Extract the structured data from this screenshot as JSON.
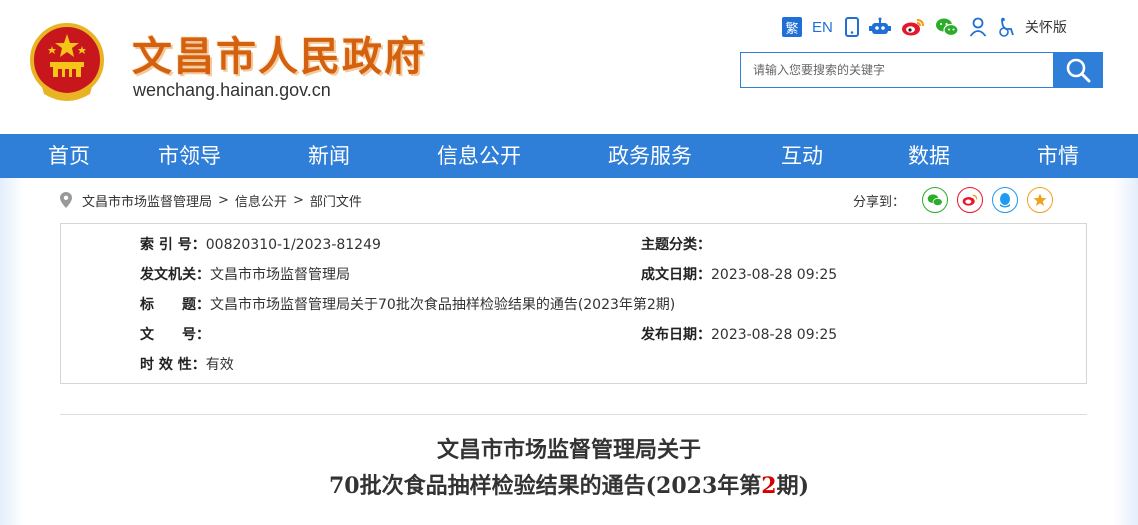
{
  "header": {
    "site_title": "文昌市人民政府",
    "site_domain": "wenchang.hainan.gov.cn",
    "tools": {
      "traditional": "繁",
      "english": "EN",
      "care_mode": "关怀版"
    },
    "search": {
      "placeholder": "请输入您要搜索的关键字"
    }
  },
  "nav": {
    "items": [
      "首页",
      "市领导",
      "新闻",
      "信息公开",
      "政务服务",
      "互动",
      "数据",
      "市情"
    ]
  },
  "breadcrumb": {
    "items": [
      "文昌市市场监督管理局",
      "信息公开",
      "部门文件"
    ],
    "separator": ">"
  },
  "share": {
    "label": "分享到："
  },
  "meta": {
    "index_label": "索 引 号：",
    "index_value": "00820310-1/2023-81249",
    "topic_label": "主题分类：",
    "topic_value": "",
    "issuer_label": "发文机关：",
    "issuer_value": "文昌市市场监督管理局",
    "created_label": "成文日期：",
    "created_value": "2023-08-28 09:25",
    "title_label": "标　　题：",
    "title_value": "文昌市市场监督管理局关于70批次食品抽样检验结果的通告(2023年第2期)",
    "docno_label": "文　　号：",
    "docno_value": "",
    "published_label": "发布日期：",
    "published_value": "2023-08-28 09:25",
    "validity_label": "时 效 性：",
    "validity_value": "有效"
  },
  "document": {
    "title_line1": "文昌市市场监督管理局关于",
    "title_line2_prefix": "70批次食品抽样检验结果的通告(2023年第",
    "title_line2_number": "2",
    "title_line2_suffix": "期)"
  },
  "colors": {
    "primary_blue": "#2f7ed8",
    "title_orange": "#d4610f",
    "accent_red": "#d40000"
  }
}
